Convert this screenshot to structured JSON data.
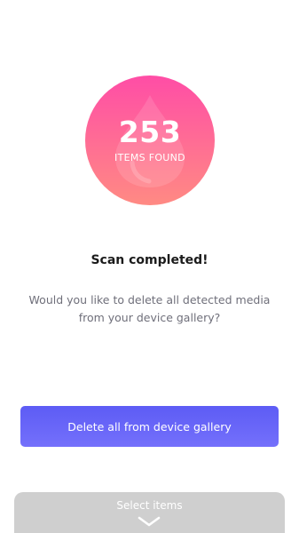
{
  "result": {
    "count": "253",
    "label": "ITEMS FOUND",
    "icon": "drop-icon"
  },
  "dialog": {
    "title": "Scan completed!",
    "message": "Would you like to delete all detected media from your device gallery?"
  },
  "actions": {
    "delete_all_label": "Delete all from device gallery",
    "select_items_label": "Select items",
    "select_items_icon": "chevron-down-icon"
  },
  "colors": {
    "circle_gradient": [
      "#ff4da6",
      "#ff8a83"
    ],
    "button_gradient": [
      "#5d5cf5",
      "#7470fb"
    ],
    "panel": "#cfcfcf"
  }
}
